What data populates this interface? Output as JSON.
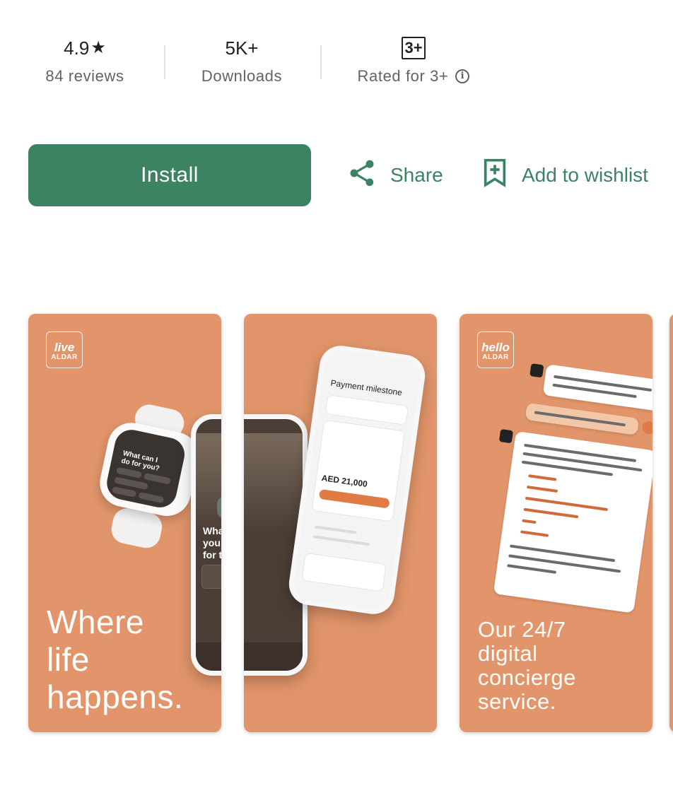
{
  "stats": {
    "rating": {
      "value": "4.9",
      "label": "84 reviews"
    },
    "downloads": {
      "value": "5K+",
      "label": "Downloads"
    },
    "content_rating": {
      "value": "3+",
      "label": "Rated for 3+"
    }
  },
  "actions": {
    "install_label": "Install",
    "share_label": "Share",
    "wishlist_label": "Add to wishlist"
  },
  "screenshots": [
    {
      "tagline": [
        "Where",
        "life",
        "happens."
      ]
    },
    {
      "tagline": []
    },
    {
      "tagline": [
        "Our 24/7",
        "digital",
        "concierge",
        "service."
      ]
    }
  ],
  "colors": {
    "accent": "#3b8363",
    "screenshot_bg": "#e2956a",
    "muted_text": "#5f6368"
  },
  "icons": [
    "star-icon",
    "info-icon",
    "share-icon",
    "bookmark-add-icon"
  ]
}
